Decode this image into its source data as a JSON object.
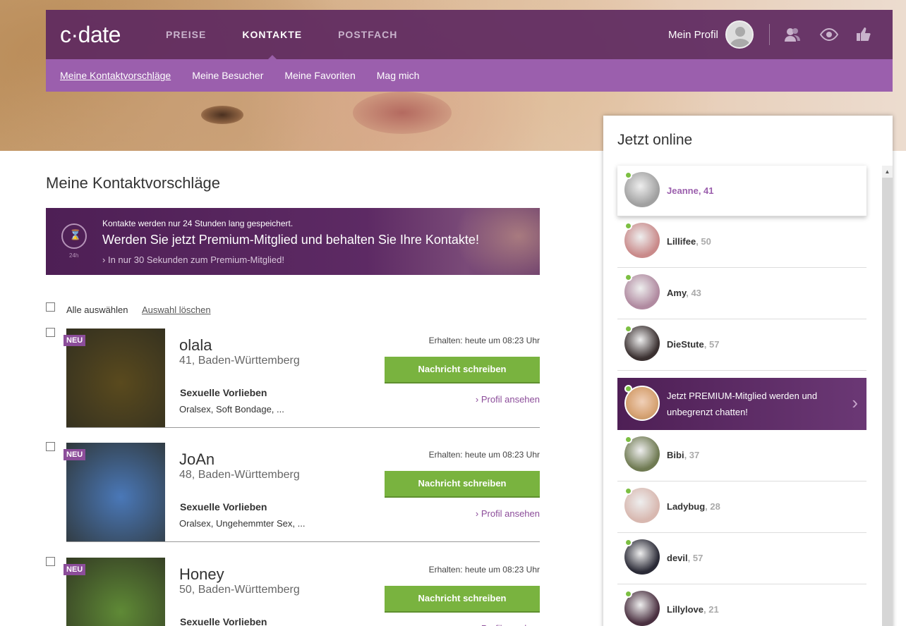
{
  "header": {
    "logo": "c·date",
    "nav": [
      "PREISE",
      "KONTAKTE",
      "POSTFACH"
    ],
    "active_nav": "KONTAKTE",
    "profile_label": "Mein Profil",
    "icons": [
      "contacts-icon",
      "eye-icon",
      "thumbs-up-icon"
    ]
  },
  "subnav": [
    "Meine Kontaktvorschläge",
    "Meine Besucher",
    "Meine Favoriten",
    "Mag mich"
  ],
  "page_title": "Meine Kontaktvorschläge",
  "banner": {
    "badge": "24h",
    "line1": "Kontakte werden nur 24 Stunden lang gespeichert.",
    "line2": "Werden Sie jetzt Premium-Mitglied und behalten Sie Ihre Kontakte!",
    "line3": "In nur 30 Sekunden zum Premium-Mitglied!"
  },
  "selection": {
    "select_all": "Alle auswählen",
    "clear": "Auswahl löschen"
  },
  "contacts": [
    {
      "badge": "NEU",
      "name": "olala",
      "location": "41, Baden-Württemberg",
      "pref_heading": "Sexuelle Vorlieben",
      "prefs": "Oralsex, Soft Bondage, ...",
      "received": "Erhalten: heute um 08:23 Uhr",
      "message_btn": "Nachricht schreiben",
      "view_link": "Profil ansehen",
      "photo_color": "#5a4a1e"
    },
    {
      "badge": "NEU",
      "name": "JoAn",
      "location": "48, Baden-Württemberg",
      "pref_heading": "Sexuelle Vorlieben",
      "prefs": "Oralsex, Ungehemmter Sex, ...",
      "received": "Erhalten: heute um 08:23 Uhr",
      "message_btn": "Nachricht schreiben",
      "view_link": "Profil ansehen",
      "photo_color": "#4a78b8"
    },
    {
      "badge": "NEU",
      "name": "Honey",
      "location": "50, Baden-Württemberg",
      "pref_heading": "Sexuelle Vorlieben",
      "prefs": "",
      "received": "Erhalten: heute um 08:23 Uhr",
      "message_btn": "Nachricht schreiben",
      "view_link": "Profil ansehen",
      "photo_color": "#5f8a36"
    }
  ],
  "online": {
    "title": "Jetzt online",
    "users_top": [
      {
        "name": "Jeanne",
        "age": ", 41",
        "color": "#a0a0a0"
      },
      {
        "name": "Lillifee",
        "age": ", 50",
        "color": "#c98a8a"
      },
      {
        "name": "Amy",
        "age": ", 43",
        "color": "#b08aa0"
      },
      {
        "name": "DieStute",
        "age": ", 57",
        "color": "#3a3030"
      }
    ],
    "promo": "Jetzt PREMIUM-Mitglied werden und unbegrenzt chatten!",
    "users_bottom": [
      {
        "name": "Bibi",
        "age": ", 37",
        "color": "#6f7a52"
      },
      {
        "name": "Ladybug",
        "age": ", 28",
        "color": "#d8b8b0"
      },
      {
        "name": "devil",
        "age": ", 57",
        "color": "#2a2a36"
      },
      {
        "name": "Lillylove",
        "age": ", 21",
        "color": "#4a3040"
      }
    ]
  }
}
